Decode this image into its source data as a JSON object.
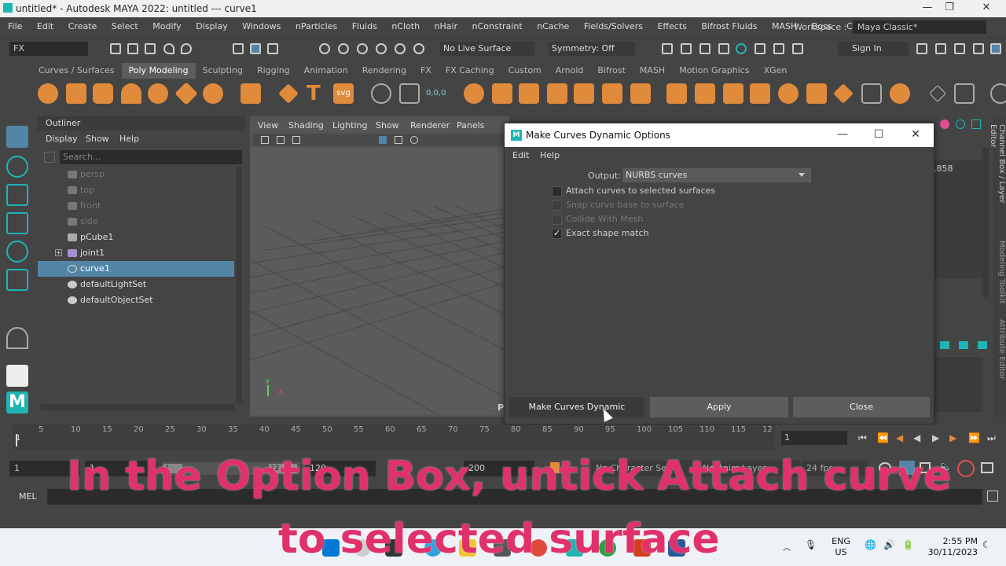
{
  "window": {
    "title": "untitled* - Autodesk MAYA 2022: untitled   ---   curve1"
  },
  "menubar": {
    "items": [
      "File",
      "Edit",
      "Create",
      "Select",
      "Modify",
      "Display",
      "Windows",
      "nParticles",
      "Fluids",
      "nCloth",
      "nHair",
      "nConstraint",
      "nCache",
      "Fields/Solvers",
      "Effects",
      "Bifrost Fluids",
      "MASH",
      "Boss",
      "Cache"
    ],
    "workspace_label": "Workspace :",
    "workspace_value": "Maya Classic*"
  },
  "statusline": {
    "menuset": "FX",
    "live_surface": "No Live Surface",
    "symmetry": "Symmetry: Off",
    "sign_in": "Sign In"
  },
  "shelf": {
    "tabs": [
      "Curves / Surfaces",
      "Poly Modeling",
      "Sculpting",
      "Rigging",
      "Animation",
      "Rendering",
      "FX",
      "FX Caching",
      "Custom",
      "Arnold",
      "Bifrost",
      "MASH",
      "Motion Graphics",
      "XGen"
    ],
    "active_tab": "Poly Modeling",
    "num_label": "0,0,0"
  },
  "outliner": {
    "title": "Outliner",
    "menu": [
      "Display",
      "Show",
      "Help"
    ],
    "search_placeholder": "Search...",
    "items": [
      {
        "label": "persp",
        "dim": true
      },
      {
        "label": "top",
        "dim": true
      },
      {
        "label": "front",
        "dim": true
      },
      {
        "label": "side",
        "dim": true
      },
      {
        "label": "pCube1",
        "dim": false
      },
      {
        "label": "joint1",
        "dim": false
      },
      {
        "label": "curve1",
        "dim": false,
        "selected": true
      },
      {
        "label": "defaultLightSet",
        "dim": false
      },
      {
        "label": "defaultObjectSet",
        "dim": false
      }
    ]
  },
  "viewport": {
    "menu": [
      "View",
      "Shading",
      "Lighting",
      "Show",
      "Renderer",
      "Panels"
    ],
    "axis_y": "y",
    "axis_x": "x",
    "label_p": "P"
  },
  "channelbox": {
    "value": ".858",
    "tab_channel": "Channel Box / Layer Editor",
    "tab_modeling": "Modeling Toolkit",
    "tab_attr": "Attribute Editor"
  },
  "dialog": {
    "title": "Make Curves Dynamic Options",
    "menu": [
      "Edit",
      "Help"
    ],
    "output_label": "Output:",
    "output_value": "NURBS curves",
    "options": [
      {
        "label": "Attach curves to selected surfaces",
        "checked": false,
        "enabled": true
      },
      {
        "label": "Snap curve base to surface",
        "checked": false,
        "enabled": false
      },
      {
        "label": "Collide With Mesh",
        "checked": false,
        "enabled": false
      },
      {
        "label": "Exact shape match",
        "checked": true,
        "enabled": true
      }
    ],
    "buttons": {
      "make": "Make Curves Dynamic",
      "apply": "Apply",
      "close": "Close"
    }
  },
  "timeslider": {
    "ticks": [
      "5",
      "10",
      "15",
      "20",
      "25",
      "30",
      "35",
      "40",
      "45",
      "50",
      "55",
      "60",
      "65",
      "70",
      "75",
      "80",
      "85",
      "90",
      "95",
      "100",
      "105",
      "110",
      "115",
      "12"
    ],
    "current_frame_marker": "1",
    "current_frame": "1"
  },
  "rangeslider": {
    "start": "1",
    "playback_start": "1",
    "range_handle_start": "1",
    "range_handle_end": "12",
    "playback_end": "120",
    "end": "200",
    "character_set": "No Character Set",
    "anim_layer": "No Anim Layer",
    "fps": "24 fps"
  },
  "cmdline": {
    "label": "MEL"
  },
  "taskbar": {
    "lang_top": "ENG",
    "lang_bottom": "US",
    "time": "2:55 PM",
    "date": "30/11/2023"
  },
  "caption": {
    "line1": "In the Option Box, untick Attach curve",
    "line2": "to selected surface"
  },
  "colors": {
    "selection": "#5285a6",
    "caption": "#e0316a",
    "shelf_icon": "#e08a3c",
    "maya_teal": "#1fb3b3"
  }
}
